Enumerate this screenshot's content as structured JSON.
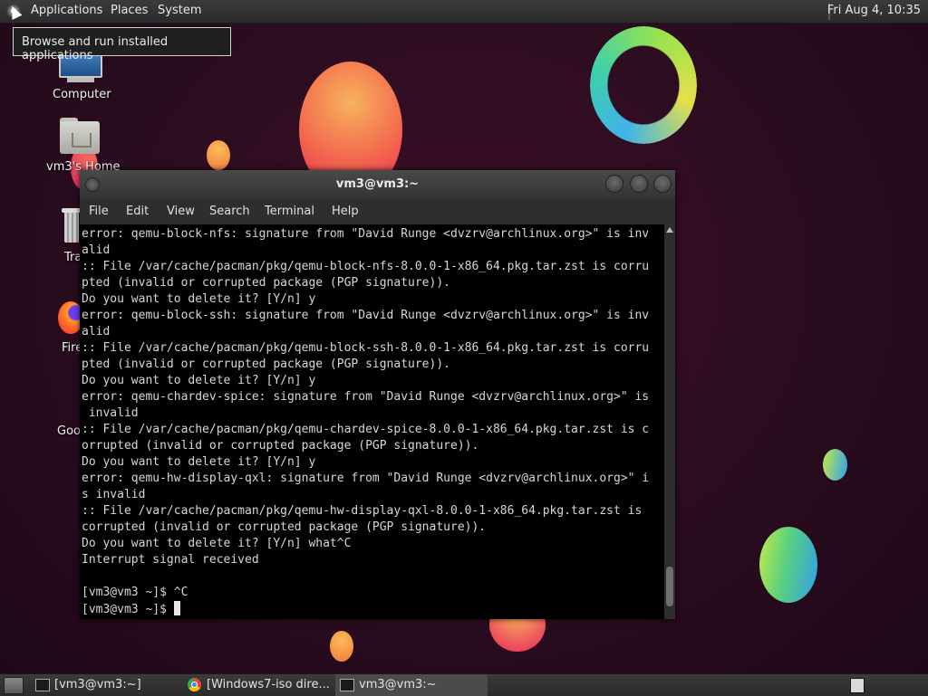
{
  "top_panel": {
    "menus": [
      "Applications",
      "Places",
      "System"
    ],
    "clock": "Fri Aug  4, 10:35",
    "tooltip": "Browse and run installed applications"
  },
  "desktop_icons": [
    {
      "label": "Computer"
    },
    {
      "label": "vm3's Home"
    },
    {
      "label": "Tra"
    },
    {
      "label": "Fire"
    },
    {
      "label": "Goo"
    }
  ],
  "terminal": {
    "title": "vm3@vm3:~",
    "menus": [
      "File",
      "Edit",
      "View",
      "Search",
      "Terminal",
      "Help"
    ],
    "lines": [
      "error: qemu-block-nfs: signature from \"David Runge <dvzrv@archlinux.org>\" is inv",
      "alid",
      ":: File /var/cache/pacman/pkg/qemu-block-nfs-8.0.0-1-x86_64.pkg.tar.zst is corru",
      "pted (invalid or corrupted package (PGP signature)).",
      "Do you want to delete it? [Y/n] y",
      "error: qemu-block-ssh: signature from \"David Runge <dvzrv@archlinux.org>\" is inv",
      "alid",
      ":: File /var/cache/pacman/pkg/qemu-block-ssh-8.0.0-1-x86_64.pkg.tar.zst is corru",
      "pted (invalid or corrupted package (PGP signature)).",
      "Do you want to delete it? [Y/n] y",
      "error: qemu-chardev-spice: signature from \"David Runge <dvzrv@archlinux.org>\" is",
      " invalid",
      ":: File /var/cache/pacman/pkg/qemu-chardev-spice-8.0.0-1-x86_64.pkg.tar.zst is c",
      "orrupted (invalid or corrupted package (PGP signature)).",
      "Do you want to delete it? [Y/n] y",
      "error: qemu-hw-display-qxl: signature from \"David Runge <dvzrv@archlinux.org>\" i",
      "s invalid",
      ":: File /var/cache/pacman/pkg/qemu-hw-display-qxl-8.0.0-1-x86_64.pkg.tar.zst is",
      "corrupted (invalid or corrupted package (PGP signature)).",
      "Do you want to delete it? [Y/n] what^C",
      "Interrupt signal received",
      "",
      "[vm3@vm3 ~]$ ^C"
    ],
    "prompt": "[vm3@vm3 ~]$ "
  },
  "taskbar": {
    "tasks": [
      {
        "label": "[vm3@vm3:~]",
        "icon": "terminal-icon",
        "active": false
      },
      {
        "label": "[Windows7-iso dire...",
        "icon": "chrome-icon",
        "active": false
      },
      {
        "label": "vm3@vm3:~",
        "icon": "terminal-icon",
        "active": true
      }
    ]
  }
}
